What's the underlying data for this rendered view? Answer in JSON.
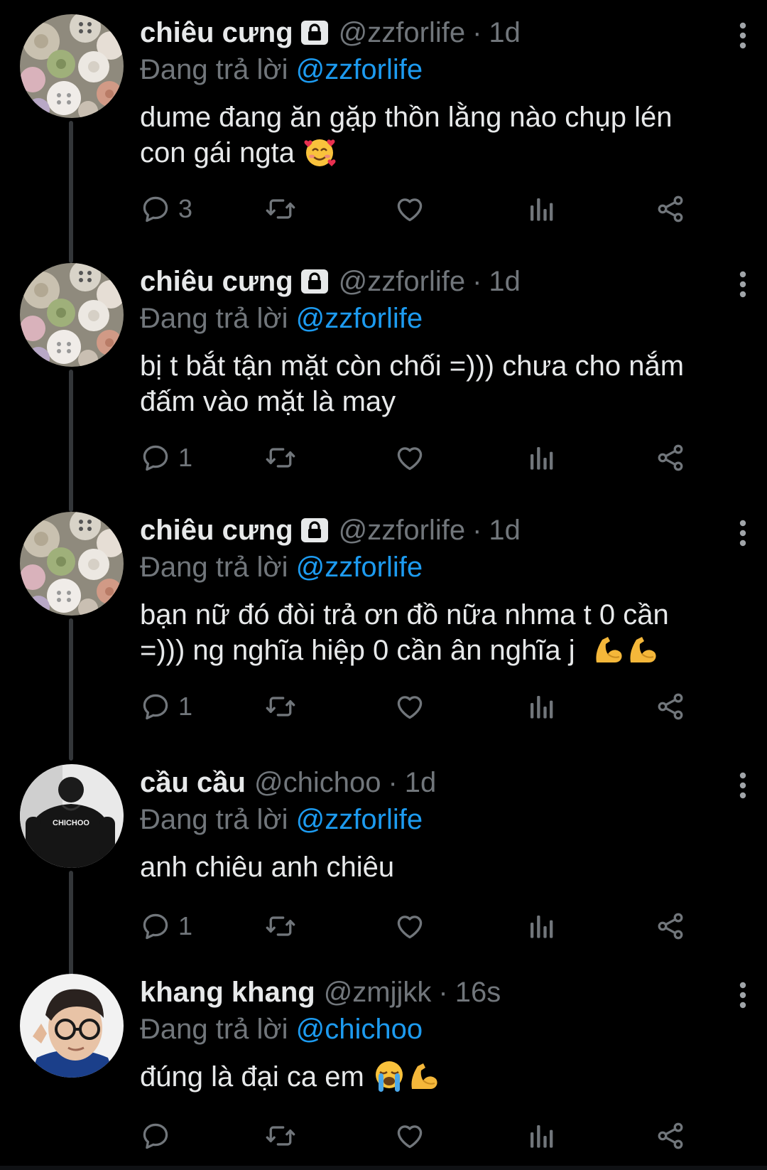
{
  "theme": {
    "background": "#000000",
    "text_primary": "#e7e9ea",
    "text_secondary": "#71767b",
    "link": "#1d9bf0",
    "thread_line": "#333639"
  },
  "tweets": [
    {
      "name": "chiêu cưng",
      "locked": true,
      "handle": "@zzforlife",
      "dot": "·",
      "time": "1d",
      "reply_prefix": "Đang trả lời ",
      "reply_to": "@zzforlife",
      "text": "dume đang ăn gặp thồn lằng nào chụp lén\ncon gái ngta ",
      "emoji": [
        "smiling-face-with-hearts"
      ],
      "reply_count": "3",
      "avatar": "buttons-avatar"
    },
    {
      "name": "chiêu cưng",
      "locked": true,
      "handle": "@zzforlife",
      "dot": "·",
      "time": "1d",
      "reply_prefix": "Đang trả lời ",
      "reply_to": "@zzforlife",
      "text": "bị t bắt tận mặt còn chối =))) chưa cho nắm\nđấm vào mặt là may",
      "emoji": [],
      "reply_count": "1",
      "avatar": "buttons-avatar"
    },
    {
      "name": "chiêu cưng",
      "locked": true,
      "handle": "@zzforlife",
      "dot": "·",
      "time": "1d",
      "reply_prefix": "Đang trả lời ",
      "reply_to": "@zzforlife",
      "text": "bạn nữ đó đòi trả ơn đồ nữa nhma t 0 cần\n=))) ng nghĩa hiệp 0 cần ân nghĩa j  ",
      "emoji": [
        "flexed-biceps",
        "flexed-biceps"
      ],
      "reply_count": "1",
      "avatar": "buttons-avatar"
    },
    {
      "name": "cầu cầu",
      "locked": false,
      "handle": "@chichoo",
      "dot": "·",
      "time": "1d",
      "reply_prefix": "Đang trả lời ",
      "reply_to": "@zzforlife",
      "text": "anh chiêu anh chiêu",
      "emoji": [],
      "reply_count": "1",
      "avatar": "chichoo-avatar",
      "avatar_text": "CHICHOO"
    },
    {
      "name": "khang khang",
      "locked": false,
      "handle": "@zmjjkk",
      "dot": "·",
      "time": "16s",
      "reply_prefix": "Đang trả lời ",
      "reply_to": "@chichoo",
      "text": "đúng là đại ca em ",
      "emoji": [
        "loudly-crying-face",
        "flexed-biceps"
      ],
      "reply_count": "",
      "avatar": "glasses-avatar"
    }
  ],
  "actions": [
    "reply-icon",
    "retweet-icon",
    "like-icon",
    "views-icon",
    "share-icon"
  ]
}
